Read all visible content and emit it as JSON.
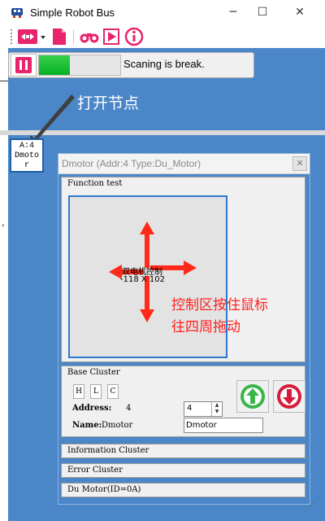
{
  "window": {
    "title": "Simple Robot Bus",
    "minimize_glyph": "─",
    "maximize_glyph": "☐",
    "close_glyph": "✕"
  },
  "toolbar": {
    "icons": [
      "connect-icon",
      "dropdown-arrow-icon",
      "new-document-icon",
      "binoculars-icon",
      "play-icon",
      "info-icon"
    ]
  },
  "status": {
    "text": "Scaning is break.",
    "progress": 0.38,
    "accent_color": "#06b025"
  },
  "annotations": {
    "open_node": "打开节点",
    "control_hint_line1": "控制区按住鼠标",
    "control_hint_line2": "往四周拖动"
  },
  "node": {
    "label_line1": "A:4",
    "label_line2": "Dmoto",
    "label_line3": "r"
  },
  "side_mark": ",",
  "panel": {
    "title": "Dmotor  (Addr:4 Type:Du_Motor)",
    "close_glyph": "✕",
    "function_test": {
      "label": "Function test",
      "control_title": "双电机控制",
      "coords": "-118  X  102"
    },
    "base_cluster": {
      "label": "Base Cluster",
      "checks": [
        "H",
        "L",
        "C"
      ],
      "address_label": "Address:",
      "address_value": "4",
      "address_input": "4",
      "name_label": "Name:",
      "name_value": "Dmotor",
      "name_input": "Dmotor"
    },
    "sections": [
      "Information Cluster",
      "Error Cluster",
      "Du Motor(ID=0A)"
    ]
  },
  "colors": {
    "background_blue": "#4a86c8",
    "annotation_red": "#ff2020",
    "upload_green": "#3ab54a",
    "download_red": "#d81b3c"
  }
}
